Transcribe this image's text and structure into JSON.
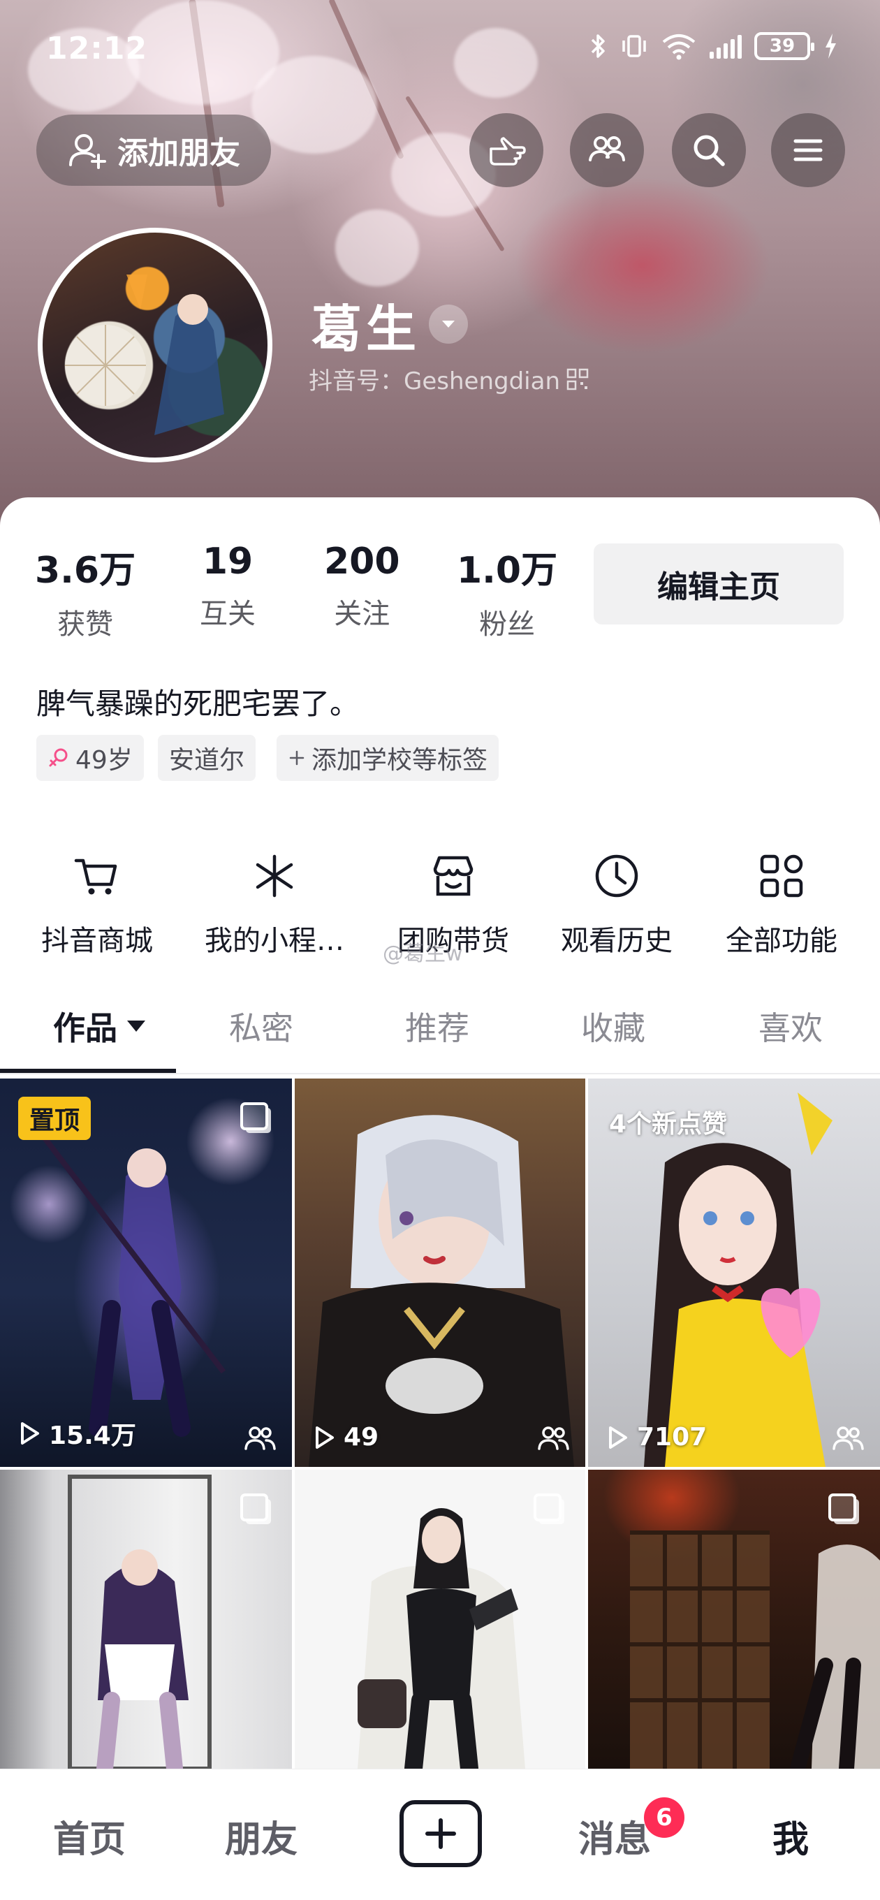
{
  "status_bar": {
    "time": "12:12",
    "battery": "39"
  },
  "header": {
    "add_friend_label": "添加朋友"
  },
  "profile": {
    "username": "葛生",
    "douyin_id": "抖音号：Geshengdian",
    "stats": [
      {
        "value": "3.6万",
        "label": "获赞"
      },
      {
        "value": "19",
        "label": "互关"
      },
      {
        "value": "200",
        "label": "关注"
      },
      {
        "value": "1.0万",
        "label": "粉丝"
      }
    ],
    "edit_button": "编辑主页",
    "bio": "脾气暴躁的死肥宅罢了。",
    "tags": {
      "age": "49岁",
      "location": "安道尔",
      "add_school": "添加学校等标签"
    }
  },
  "features": [
    {
      "label": "抖音商城",
      "icon": "cart-icon"
    },
    {
      "label": "我的小程…",
      "icon": "mini-program-icon"
    },
    {
      "label": "团购带货",
      "icon": "shop-icon"
    },
    {
      "label": "观看历史",
      "icon": "clock-icon"
    },
    {
      "label": "全部功能",
      "icon": "grid-icon"
    }
  ],
  "watermark": "@葛生w",
  "tabs": [
    "作品",
    "私密",
    "推荐",
    "收藏",
    "喜欢"
  ],
  "grid": {
    "pinned_label": "置顶",
    "new_likes_label": "4个新点赞",
    "play_counts": [
      "15.4万",
      "49",
      "7107"
    ]
  },
  "bottom_nav": {
    "home": "首页",
    "friends": "朋友",
    "messages": "消息",
    "me": "我",
    "message_badge": "6"
  },
  "colors": {
    "accent": "#fe2c55",
    "pin_badge": "#f8c21a",
    "text": "#161823"
  }
}
